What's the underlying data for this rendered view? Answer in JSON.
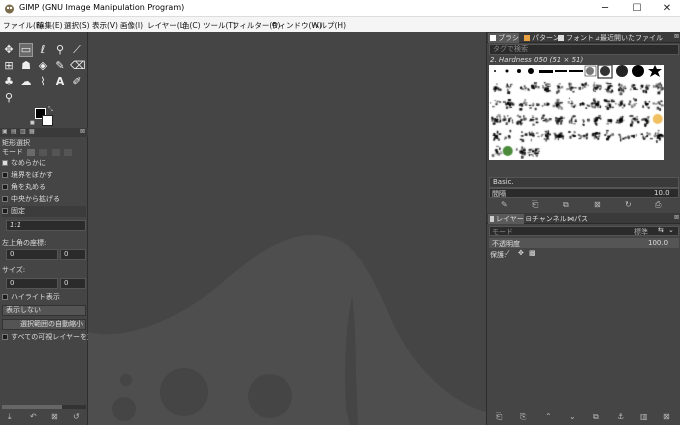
{
  "window": {
    "title": "GIMP (GNU Image Manipulation Program)",
    "minimize": "─",
    "maximize": "☐",
    "close": "✕"
  },
  "menu": [
    "ファイル(F)",
    "編集(E)",
    "選択(S)",
    "表示(V)",
    "画像(I)",
    "レイヤー(L)",
    "色(C)",
    "ツール(T)",
    "フィルター(R)",
    "ウィンドウ(W)",
    "ヘルプ(H)"
  ],
  "toolbox": {
    "tools": [
      "move",
      "rect-select",
      "lasso",
      "fuzzy-select",
      "crop",
      "unified-transform",
      "warp",
      "bucket-fill",
      "paintbrush",
      "eraser",
      "clone",
      "smudge",
      "path",
      "text",
      "color-picker",
      "zoom"
    ]
  },
  "tool_options": {
    "title": "矩形選択",
    "mode_label": "モード",
    "antialias": "なめらかに",
    "feather": "境界をぼかす",
    "rounded": "角を丸める",
    "expand_center": "中央から拡げる",
    "fixed_label": "固定",
    "ratio_value": "1:1",
    "position_label": "左上角の座標:",
    "pos_x": "0",
    "pos_y": "0",
    "size_label": "サイズ:",
    "size_w": "0",
    "size_h": "0",
    "highlight": "ハイライト表示",
    "guides_value": "表示しない",
    "autoshrink": "選択範囲の自動縮小",
    "sample_merged": "すべての可視レイヤーを対象"
  },
  "right_panel": {
    "tabs_top": [
      "ブラシ",
      "パターン",
      "フォント",
      "最近開いたファイル"
    ],
    "tag_placeholder": "タグで検索",
    "brush_name": "2. Hardness 050 (51 × 51)",
    "brush_preset": "Basic.",
    "spacing_label": "間隔",
    "spacing_value": "10.0",
    "tabs_layers": [
      "レイヤー",
      "チャンネル",
      "パス"
    ],
    "mode_label": "モード",
    "mode_value": "標準",
    "opacity_label": "不透明度",
    "opacity_value": "100.0",
    "lock_label": "保護:"
  },
  "colors": {
    "accent": "#6a9fd4",
    "panel_bg": "#454545",
    "canvas_bg": "#454545",
    "wilber": "#4e4e4e"
  }
}
